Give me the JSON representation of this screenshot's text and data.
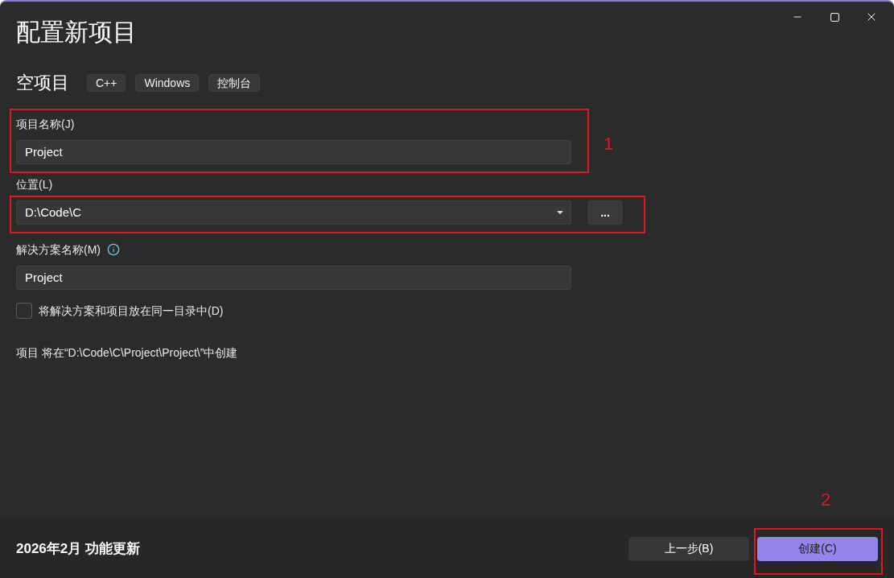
{
  "window": {
    "title": "配置新项目"
  },
  "template": {
    "name": "空项目",
    "tags": [
      "C++",
      "Windows",
      "控制台"
    ]
  },
  "fields": [
    {
      "kind": "text",
      "label": "项目名称(J)",
      "value": "Project",
      "highlighted": true,
      "callout": "1"
    },
    {
      "kind": "dropdown",
      "label": "位置(L)",
      "value": "D:\\Code\\C",
      "browse_button": "...",
      "highlighted": true
    },
    {
      "kind": "text",
      "label": "解决方案名称(M)",
      "info": true,
      "value": "Project",
      "highlighted": false
    }
  ],
  "same_directory": {
    "label": "将解决方案和项目放在同一目录中(D)",
    "checked": false
  },
  "summary": "项目 将在“D:\\Code\\C\\Project\\Project\\”中创建",
  "footer": {
    "update_note": "2026年2月 功能更新",
    "buttons": [
      {
        "kind": "secondary",
        "label": "上一步(B)",
        "highlighted": false
      },
      {
        "kind": "primary",
        "label": "创建(C)",
        "highlighted": true,
        "callout": "2"
      }
    ]
  }
}
